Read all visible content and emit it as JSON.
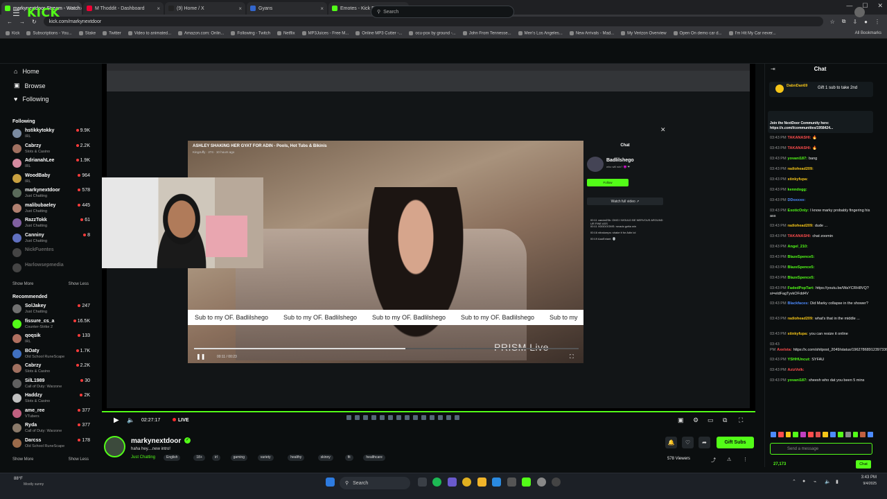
{
  "browser": {
    "tabs": [
      {
        "label": "markynextdoor Stream - Watch",
        "active": true,
        "color": "#53fc18"
      },
      {
        "label": "M Thoddit - Dashboard",
        "active": false,
        "color": "#e03"
      },
      {
        "label": "(9) Home / X",
        "active": false,
        "color": "#222"
      },
      {
        "label": "Gyans",
        "active": false,
        "color": "#36c"
      },
      {
        "label": "Emotes - Kick Dashboard",
        "active": false,
        "color": "#53fc18"
      }
    ],
    "new_tab": "+",
    "url": "kick.com/markynextdoor",
    "bookmarks": [
      "Kick",
      "Subscriptions - You...",
      "Stake",
      "Twitter",
      "Video to animated...",
      "Amazon.com: Onlin...",
      "Following - Twitch",
      "Netflix",
      "MP3Juices - Free M...",
      "Online MP3 Cutter -...",
      "ocu-pox by ground -...",
      "John From Tennesse...",
      "Men's Los Angeles...",
      "New Arrivals - Mad...",
      "My Verizon Overview",
      "Open On demo car d...",
      "I'm Hit My Car never..."
    ],
    "all_bookmarks": "All Bookmarks"
  },
  "header": {
    "logo": "KICK",
    "search_placeholder": "Search"
  },
  "sidebar": {
    "nav": [
      {
        "label": "Home",
        "icon": "home-icon",
        "glyph": "⌂"
      },
      {
        "label": "Browse",
        "icon": "browse-icon",
        "glyph": "▣"
      },
      {
        "label": "Following",
        "icon": "heart-icon",
        "glyph": "♥"
      }
    ],
    "following_header": "Following",
    "following": [
      {
        "name": "hstikkytokky",
        "cat": "IRL",
        "viewers": "9.9K",
        "color": "#7a8aa0"
      },
      {
        "name": "Cabrzy",
        "cat": "Slots & Casino",
        "viewers": "2.2K",
        "color": "#a07060"
      },
      {
        "name": "AdrianahLee",
        "cat": "IRL",
        "viewers": "1.9K",
        "color": "#d58aa0"
      },
      {
        "name": "WoodBaby",
        "cat": "IRL",
        "viewers": "964",
        "color": "#c8a040"
      },
      {
        "name": "markynextdoor",
        "cat": "Just Chatting",
        "viewers": "578",
        "color": "#5a6a5a"
      },
      {
        "name": "malibubaeley",
        "cat": "Just Chatting",
        "viewers": "445",
        "color": "#b08070"
      },
      {
        "name": "RazzTokk",
        "cat": "Just Chatting",
        "viewers": "61",
        "color": "#8060a0"
      },
      {
        "name": "Canniny",
        "cat": "Just Chatting",
        "viewers": "8",
        "color": "#6070c0"
      },
      {
        "name": "NickFuentes",
        "cat": "",
        "viewers": "",
        "color": "#444",
        "offline": true
      },
      {
        "name": "Harlowsepmedia",
        "cat": "",
        "viewers": "",
        "color": "#444",
        "offline": true
      }
    ],
    "show_more": "Show More",
    "show_less": "Show Less",
    "recommended_header": "Recommended",
    "recommended": [
      {
        "name": "SolJakey",
        "cat": "Just Chatting",
        "viewers": "247",
        "color": "#707070"
      },
      {
        "name": "fissure_cs_a",
        "cat": "Counter-Strike 2",
        "viewers": "16.5K",
        "color": "#53fc18"
      },
      {
        "name": "qoqsik",
        "cat": "IRL",
        "viewers": "133",
        "color": "#b07060"
      },
      {
        "name": "BOaty",
        "cat": "Old School RuneScape",
        "viewers": "1.7K",
        "color": "#4070c0"
      },
      {
        "name": "Cabrzy",
        "cat": "Slots & Casino",
        "viewers": "2.2K",
        "color": "#a07060"
      },
      {
        "name": "SilL1989",
        "cat": "Call of Duty: Warzone",
        "viewers": "30",
        "color": "#606060"
      },
      {
        "name": "Haddzy",
        "cat": "Slots & Casino",
        "viewers": "2K",
        "color": "#c0c0c0"
      },
      {
        "name": "ame_ree",
        "cat": "VTubers",
        "viewers": "377",
        "color": "#c06080"
      },
      {
        "name": "Ryda",
        "cat": "Call of Duty: Warzone",
        "viewers": "377",
        "color": "#8a7a6a"
      },
      {
        "name": "Darcss",
        "cat": "Old School RuneScape",
        "viewers": "178",
        "color": "#9a6a4a"
      }
    ]
  },
  "video_modal": {
    "title": "ASHLEY SHAKING HER GYAT FOR ADIN - Pools, Hot Tubs & Bikinis",
    "subtitle": "KingJuffy · 274 · 10 hours ago",
    "marquee": [
      "Sub to my OF. Badlilshego",
      "Sub to my OF. Badlilshego",
      "Sub to my OF. Badlilshego",
      "Sub to my OF. Badlilshego",
      "Sub to my"
    ],
    "watermark": "PRISM Live",
    "time": "00:11 / 00:23",
    "progress": 0.55,
    "chat_title": "Chat",
    "channel": "Badlilshego",
    "channel_sub": "who will win? 😈 ❤",
    "follow": "Follow",
    "watch_full": "Watch full video ↗",
    "messages": [
      "00:11 vandal23k: OMG I WOULD BE NERVOUS AROUND UR FINE ASS",
      "00:11 XDDDOOMS: rovado gotta win",
      "00:16 nitralumps: shake it for Adin lol",
      "00:19 AaoExtant: 💀"
    ]
  },
  "player": {
    "time": "02:27:17",
    "live": "LIVE"
  },
  "stream": {
    "streamer": "markynextdoor",
    "title": "haha hey....new intro!",
    "category": "Just Chatting",
    "tags": [
      "English",
      "18+",
      "irl",
      "gaming",
      "variety",
      "healthy",
      "skinny",
      "fit",
      "healthcare"
    ],
    "viewers": "578 Viewers",
    "gift_subs": "Gift Subs"
  },
  "chat": {
    "title": "Chat",
    "pinned_user": "DabnDan69",
    "pinned_text": "Gift 1 sub to take 2nd",
    "announcement": "Join the NextDoor Community here: https://x.com/i/communities/1958424...",
    "messages": [
      {
        "ts": "03:43 PM",
        "user": "TAKANASHI:",
        "text": "🔥",
        "color": "#ff4d4d"
      },
      {
        "ts": "03:43 PM",
        "user": "TAKANASHI:",
        "text": "🔥",
        "color": "#ff4d4d"
      },
      {
        "ts": "03:43 PM",
        "user": "yovani187:",
        "text": "bang",
        "color": "#53fc18"
      },
      {
        "ts": "03:43 PM",
        "user": "radiohead209:",
        "text": "",
        "color": "#f5c518"
      },
      {
        "ts": "03:43 PM",
        "user": "stinkyfupa:",
        "text": "",
        "color": "#f5c518"
      },
      {
        "ts": "03:43 PM",
        "user": "kenndogg:",
        "text": "",
        "color": "#53fc18"
      },
      {
        "ts": "03:43 PM",
        "user": "DDoxxxo:",
        "text": "",
        "color": "#4d8bff"
      },
      {
        "ts": "03:43 PM",
        "user": "ExoticOnly:",
        "text": "I know marky probably fingering his ass",
        "color": "#53fc18"
      },
      {
        "ts": "03:43 PM",
        "user": "radiohead209:",
        "text": "dude ...",
        "color": "#f5c518"
      },
      {
        "ts": "03:43 PM",
        "user": "TAKANASHI:",
        "text": "chat zoomin",
        "color": "#ff4d4d"
      },
      {
        "ts": "03:43 PM",
        "user": "Angel_210:",
        "text": "",
        "color": "#53fc18"
      },
      {
        "ts": "03:43 PM",
        "user": "BlazeSpence5:",
        "text": "",
        "color": "#53fc18"
      },
      {
        "ts": "03:43 PM",
        "user": "BlazeSpence5:",
        "text": "",
        "color": "#53fc18"
      },
      {
        "ts": "03:43 PM",
        "user": "BlazeSpence5:",
        "text": "",
        "color": "#53fc18"
      },
      {
        "ts": "03:43 PM",
        "user": "FadedPopTart:",
        "text": "https://youtu.be/WaYCRH8VQ?si=eldFagTyvkOFdd4V",
        "color": "#53fc18"
      },
      {
        "ts": "03:43 PM",
        "user": "Blackfaces:",
        "text": "Did Marky collapse in the shower?",
        "color": "#4d8bff"
      },
      {
        "ts": "03:43 PM",
        "user": "radiohead209:",
        "text": "what's that in the middle ...",
        "color": "#f5c518"
      },
      {
        "ts": "03:43 PM",
        "user": "stinkyfupa:",
        "text": "you can resize it online",
        "color": "#f5c518"
      },
      {
        "ts": "03:43 PM",
        "user": "Axelsta:",
        "text": "https://x.com/shitpost_2049/status/1962786891239733693",
        "color": "#ff4d4d"
      },
      {
        "ts": "03:43 PM",
        "user": "YSHHUncut:",
        "text": "SYFAU",
        "color": "#53fc18"
      },
      {
        "ts": "03:43 PM",
        "user": "AzizVolk:",
        "text": "",
        "color": "#ff4d4d"
      },
      {
        "ts": "03:43 PM",
        "user": "yovani187:",
        "text": "sheesh who dat you been 5 mins",
        "color": "#53fc18"
      }
    ],
    "input_placeholder": "Send a message",
    "points": "27,173",
    "send": "Chat"
  },
  "taskbar": {
    "weather": "88°F",
    "weather_sub": "Mostly sunny",
    "search": "Search",
    "time": "3:43 PM",
    "date": "9/4/2025"
  }
}
